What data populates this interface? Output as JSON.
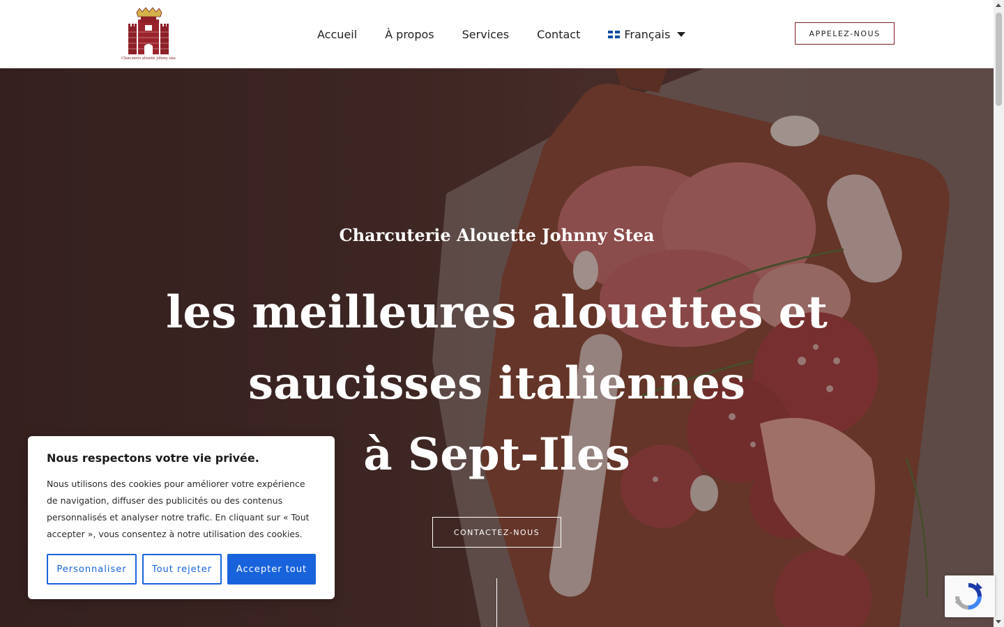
{
  "header": {
    "logo_alt": "Charcuterie alouette johnny stea",
    "nav": [
      "Accueil",
      "À propos",
      "Services",
      "Contact"
    ],
    "language": "Français",
    "call_button": "APPELEZ-NOUS"
  },
  "hero": {
    "eyebrow": "Charcuterie Alouette Johnny Stea",
    "headline_lines": [
      "les meilleures alouettes et",
      "saucisses italiennes",
      "à Sept-Iles"
    ],
    "cta": "CONTACTEZ-NOUS"
  },
  "cookie": {
    "title": "Nous respectons votre vie privée.",
    "text": "Nous utilisons des cookies pour améliorer votre expérience de navigation, diffuser des publicités ou des contenus personnalisés et analyser notre trafic. En cliquant sur « Tout accepter », vous consentez à notre utilisation des cookies.",
    "buttons": {
      "customize": "Personnaliser",
      "reject": "Tout rejeter",
      "accept": "Accepter tout"
    }
  },
  "icons": {
    "logo": "castle-crown-logo-icon",
    "language_flag": "quebec-flag-icon",
    "language_caret": "caret-down-icon",
    "recaptcha": "recaptcha-icon"
  },
  "colors": {
    "brand": "#7a1e23",
    "cookie_accent": "#1863dc",
    "hero_dark": "#3e2826"
  }
}
